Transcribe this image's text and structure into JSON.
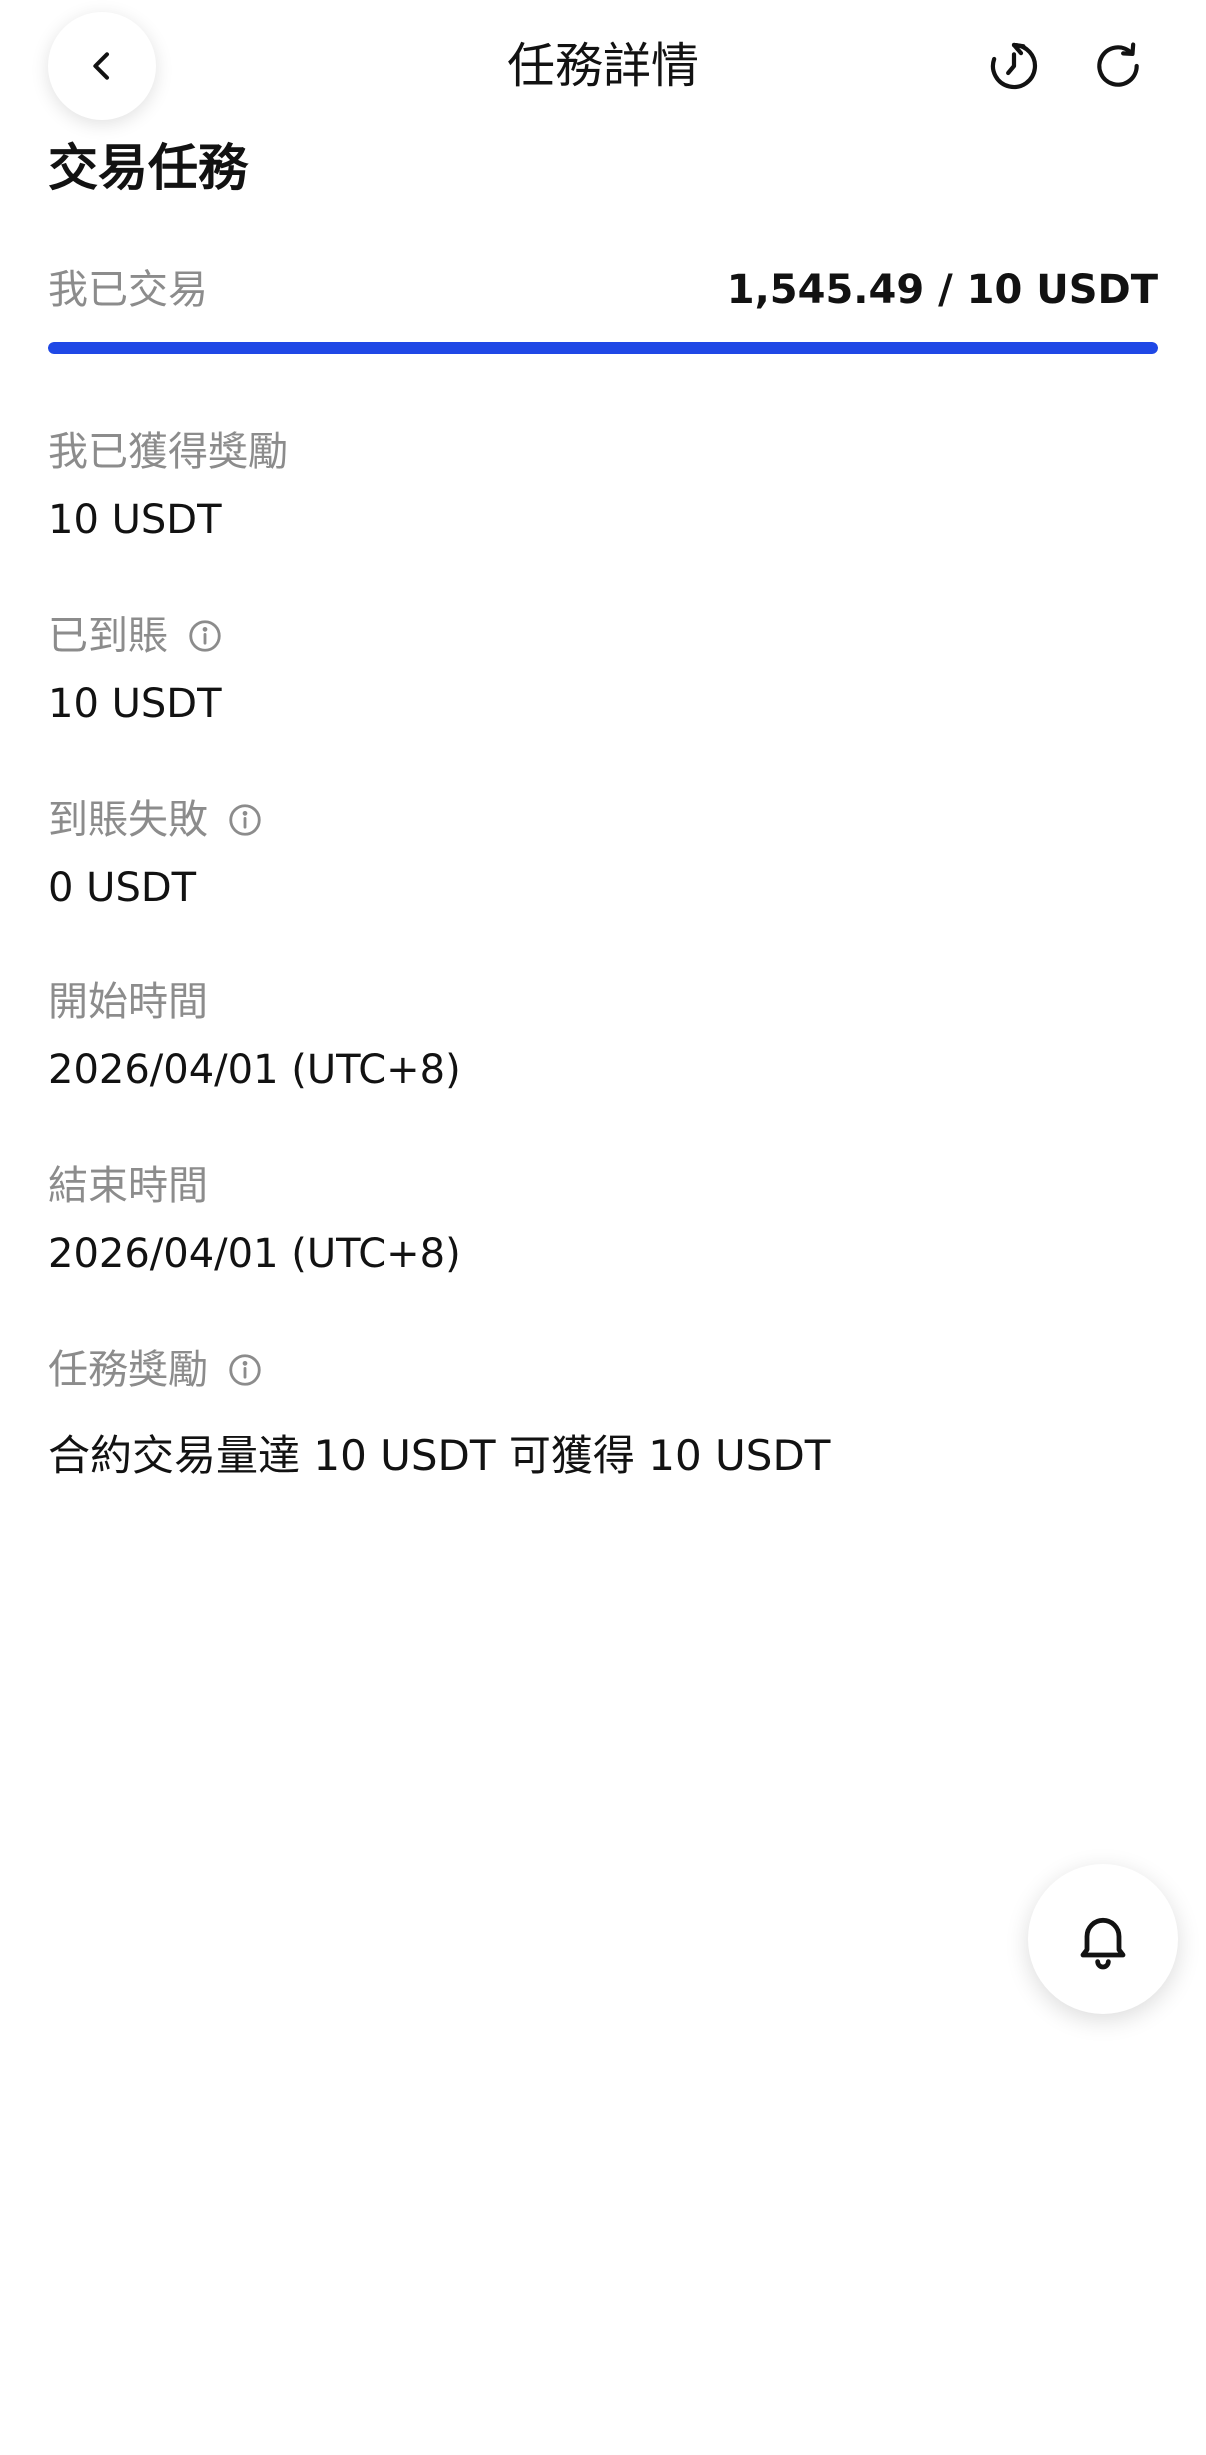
{
  "header": {
    "title": "任務詳情",
    "back_icon": "chevron-left-icon",
    "history_icon": "history-clock-icon",
    "refresh_icon": "refresh-icon"
  },
  "task": {
    "section_title": "交易任務",
    "traded_label": "我已交易",
    "traded_value": "1,545.49 / 10 USDT",
    "progress_fraction": 1.0,
    "accent_color": "#1f48e6"
  },
  "fields": {
    "earned": {
      "label": "我已獲得獎勵",
      "value": "10 USDT"
    },
    "credited": {
      "label": "已到賬",
      "value": "10 USDT"
    },
    "failed": {
      "label": "到賬失敗",
      "value": "0 USDT"
    },
    "start": {
      "label": "開始時間",
      "value": "2026/04/01 (UTC+8)"
    },
    "end": {
      "label": "結束時間",
      "value": "2026/04/01 (UTC+8)"
    },
    "reward": {
      "label": "任務獎勵",
      "value": "合約交易量達 10 USDT 可獲得 10 USDT"
    }
  },
  "floating": {
    "bell_icon": "bell-icon"
  }
}
